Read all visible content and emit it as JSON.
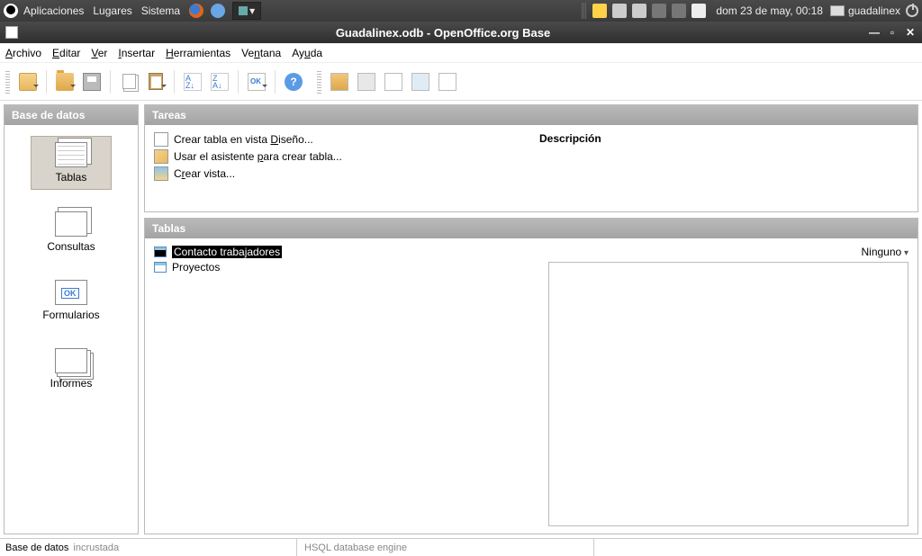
{
  "syspanel": {
    "menus": [
      "Aplicaciones",
      "Lugares",
      "Sistema"
    ],
    "datetime": "dom 23 de may, 00:18",
    "task_label": "guadalinex"
  },
  "window": {
    "title": "Guadalinex.odb - OpenOffice.org Base"
  },
  "menubar": [
    {
      "u": "A",
      "rest": "rchivo"
    },
    {
      "u": "E",
      "rest": "ditar"
    },
    {
      "u": "V",
      "rest": "er"
    },
    {
      "u": "I",
      "rest": "nsertar"
    },
    {
      "u": "H",
      "rest": "erramientas"
    },
    {
      "pre": "Ve",
      "u": "n",
      "rest": "tana"
    },
    {
      "pre": "Ay",
      "u": "u",
      "rest": "da"
    }
  ],
  "sidebar": {
    "header": "Base de datos",
    "items": [
      {
        "label": "Tablas",
        "kind": "tables",
        "selected": true
      },
      {
        "label": "Consultas",
        "kind": "query",
        "selected": false
      },
      {
        "label": "Formularios",
        "kind": "forms",
        "selected": false
      },
      {
        "label": "Informes",
        "kind": "reports",
        "selected": false
      }
    ]
  },
  "tasks": {
    "header": "Tareas",
    "desc_header": "Descripción",
    "items": [
      {
        "text": "Crear tabla en vista Diseño...",
        "u_pos": "D",
        "icon": "design"
      },
      {
        "text": "Usar el asistente para crear tabla...",
        "u_pos": "p",
        "icon": "wizard"
      },
      {
        "text": "Crear vista...",
        "u_pos": "r",
        "icon": "view"
      }
    ]
  },
  "tables": {
    "header": "Tablas",
    "items": [
      {
        "name": "Contacto trabajadores",
        "selected": true
      },
      {
        "name": "Proyectos",
        "selected": false
      }
    ],
    "preview_mode": "Ninguno"
  },
  "statusbar": {
    "db_label": "Base de datos",
    "db_value": "incrustada",
    "engine": "HSQL database engine"
  }
}
